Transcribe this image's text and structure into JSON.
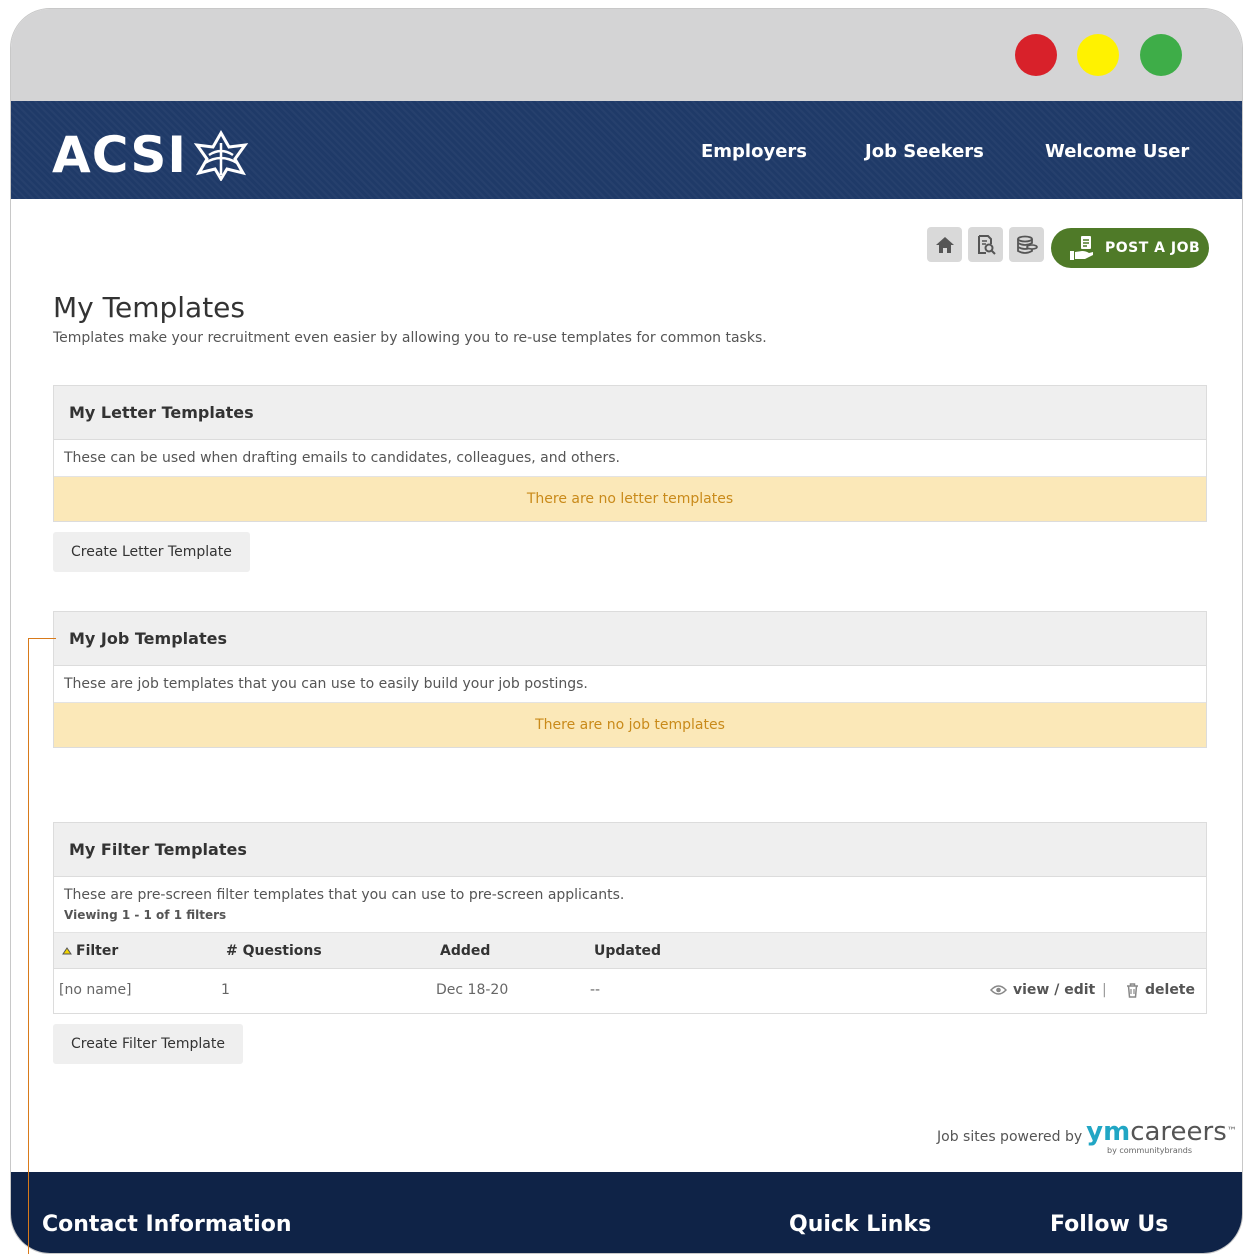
{
  "brand": {
    "logo_text": "ACSI"
  },
  "nav": {
    "employers": "Employers",
    "job_seekers": "Job Seekers",
    "welcome": "Welcome User"
  },
  "toolbar": {
    "post_job": "POST A JOB"
  },
  "page": {
    "title": "My Templates",
    "subtitle": "Templates make your recruitment even easier by allowing you to re-use templates for common tasks."
  },
  "letter": {
    "title": "My Letter Templates",
    "desc": "These can be used when drafting emails to candidates, colleagues, and others.",
    "empty": "There are no letter templates",
    "create": "Create Letter Template"
  },
  "job": {
    "title": "My Job Templates",
    "desc": "These are job templates that you can use to easily build your job postings.",
    "empty": "There are no job templates"
  },
  "filter": {
    "title": "My Filter Templates",
    "desc": "These are pre-screen filter templates that you can use to pre-screen applicants.",
    "viewing": "Viewing 1 - 1 of 1 filters",
    "columns": {
      "filter": "Filter",
      "questions": "# Questions",
      "added": "Added",
      "updated": "Updated"
    },
    "rows": [
      {
        "name": "[no name]",
        "questions": "1",
        "added": "Dec 18-20",
        "updated": "--",
        "view": "view / edit",
        "sep": "|",
        "delete": "delete"
      }
    ],
    "create": "Create Filter Template"
  },
  "powered": {
    "prefix": "Job sites powered by",
    "ym": "ym",
    "careers": "careers",
    "tm": "™",
    "by": "by communitybrands"
  },
  "footer": {
    "contact": "Contact Information",
    "quick": "Quick Links",
    "follow": "Follow Us"
  },
  "colors": {
    "header": "#1f3a68",
    "footer": "#0f2347",
    "accent": "#4f7a28",
    "empty_bg": "#fbe8b8",
    "empty_text": "#c98a1a"
  }
}
